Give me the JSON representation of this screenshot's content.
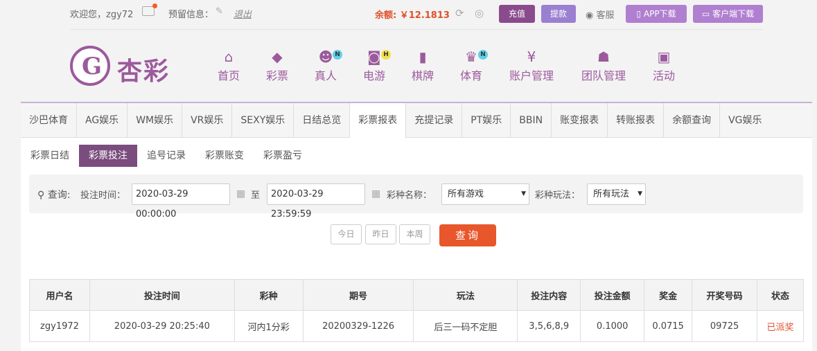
{
  "topbar": {
    "welcome": "欢迎您，zgy72",
    "reserve_label": "预留信息：",
    "edit_icon": "edit-icon",
    "logout": "退出",
    "balance": "余额: ￥12.1813",
    "recharge": "充值",
    "withdraw": "提款",
    "service": "客服",
    "app_download": "APP下载",
    "client_download": "客户端下载"
  },
  "logo": {
    "text": "杏彩"
  },
  "nav": [
    {
      "label": "首页",
      "icon": "home-icon",
      "badge": ""
    },
    {
      "label": "彩票",
      "icon": "ticket-icon",
      "badge": ""
    },
    {
      "label": "真人",
      "icon": "person-icon",
      "badge": "N"
    },
    {
      "label": "电游",
      "icon": "gamepad-icon",
      "badge": "H"
    },
    {
      "label": "棋牌",
      "icon": "cards-icon",
      "badge": ""
    },
    {
      "label": "体育",
      "icon": "trophy-icon",
      "badge": "N"
    },
    {
      "label": "账户管理",
      "icon": "yen-icon",
      "badge": ""
    },
    {
      "label": "团队管理",
      "icon": "team-icon",
      "badge": ""
    },
    {
      "label": "活动",
      "icon": "gift-icon",
      "badge": ""
    }
  ],
  "tabs": [
    "沙巴体育",
    "AG娱乐",
    "WM娱乐",
    "VR娱乐",
    "SEXY娱乐",
    "日结总览",
    "彩票报表",
    "充提记录",
    "PT娱乐",
    "BBIN",
    "账变报表",
    "转账报表",
    "余额查询",
    "VG娱乐"
  ],
  "active_tab": "彩票报表",
  "subtabs": [
    "彩票日结",
    "彩票投注",
    "追号记录",
    "彩票账变",
    "彩票盈亏"
  ],
  "active_subtab": "彩票投注",
  "query": {
    "label": "查询:",
    "time_label": "投注时间：",
    "start": "2020-03-29 00:00:00",
    "to": "至",
    "end": "2020-03-29 23:59:59",
    "game_label": "彩种名称：",
    "game_value": "所有游戏",
    "play_label": "彩种玩法：",
    "play_value": "所有玩法",
    "today": "今日",
    "yesterday": "昨日",
    "this_week": "本周",
    "search": "查询"
  },
  "table": {
    "headers": [
      "用户名",
      "投注时间",
      "彩种",
      "期号",
      "玩法",
      "投注内容",
      "投注金额",
      "奖金",
      "开奖号码",
      "状态"
    ],
    "rows": [
      [
        "zgy1972",
        "2020-03-29 20:25:40",
        "河内1分彩",
        "20200329-1226",
        "后三一码不定胆",
        "3,5,6,8,9",
        "0.1000",
        "0.0715",
        "09725",
        "已派奖"
      ]
    ]
  },
  "colors": {
    "brand": "#9c5a9c",
    "accent": "#e8572c",
    "active_subtab": "#7b4c7e"
  }
}
